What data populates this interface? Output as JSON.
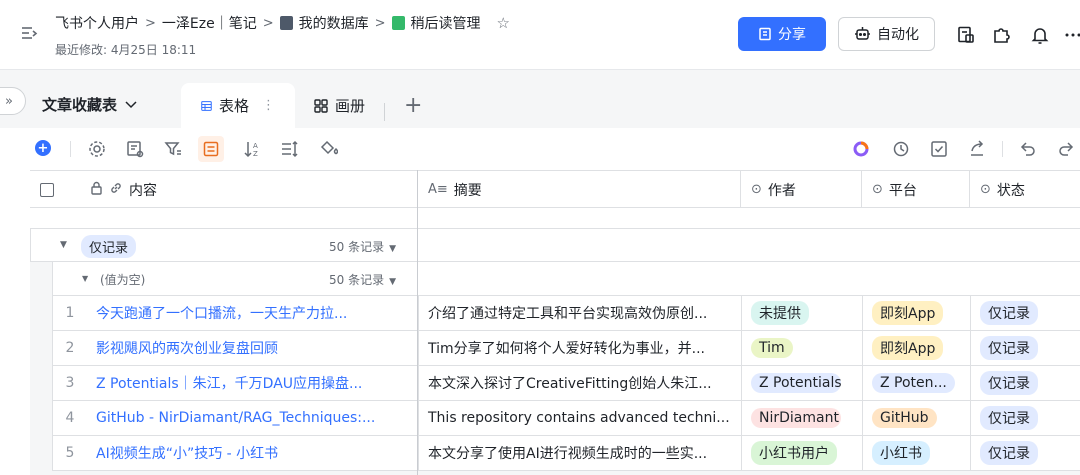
{
  "header": {
    "breadcrumbs": [
      "飞书个人用户",
      "一泽Eze｜笔记",
      "我的数据库",
      "稍后读管理"
    ],
    "last_modified": "最近修改: 4月25日 18:11",
    "share_label": "分享",
    "automation_label": "自动化"
  },
  "view": {
    "table_name": "文章收藏表",
    "tabs": [
      {
        "label": "表格",
        "active": true
      },
      {
        "label": "画册",
        "active": false
      }
    ]
  },
  "grid": {
    "columns": [
      "内容",
      "摘要",
      "作者",
      "平台",
      "状态"
    ],
    "group_level1": {
      "label": "仅记录",
      "count": "50 条记录"
    },
    "group_level2": {
      "label": "(值为空)",
      "count": "50 条记录"
    },
    "rows": [
      {
        "num": "1",
        "title": "今天跑通了一个口播流，一天生产力拉...",
        "summary": "介绍了通过特定工具和平台实现高效伪原创...",
        "author": "未提供",
        "platform": "即刻App",
        "status": "仅记录"
      },
      {
        "num": "2",
        "title": "影视飓风的两次创业复盘回顾",
        "summary": "Tim分享了如何将个人爱好转化为事业，并...",
        "author": "Tim",
        "platform": "即刻App",
        "status": "仅记录"
      },
      {
        "num": "3",
        "title": "Z Potentials｜朱江，千万DAU应用操盘...",
        "summary": "本文深入探讨了CreativeFitting创始人朱江...",
        "author": "Z Potentials",
        "platform": "Z Poten...",
        "status": "仅记录"
      },
      {
        "num": "4",
        "title": "GitHub - NirDiamant/RAG_Techniques:...",
        "summary": "This repository contains advanced techni...",
        "author": "NirDiamant",
        "platform": "GitHub",
        "status": "仅记录"
      },
      {
        "num": "5",
        "title": "AI视频生成“小”技巧 - 小红书",
        "summary": "本文分享了使用AI进行视频生成时的一些实...",
        "author": "小红书用户",
        "platform": "小红书",
        "status": "仅记录"
      }
    ]
  },
  "colors": {
    "accent": "#3370ff",
    "tag_author": [
      "#d9f5f0",
      "#eaf5c6",
      "#e1eaff",
      "#fde2e2",
      "#d9f5d6"
    ],
    "tag_platform": [
      "#fff0c2",
      "#fff0c2",
      "#e1eaff",
      "#ffe4c4",
      "#d6efff"
    ],
    "tag_status": "#e1eaff"
  }
}
